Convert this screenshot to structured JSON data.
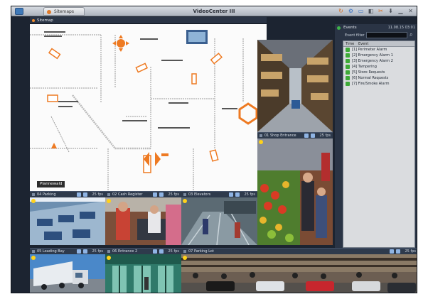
{
  "app": {
    "title": "VideoCenter III",
    "tab_label": "Sitemaps"
  },
  "toolbar_icons": [
    "refresh-icon",
    "settings-icon",
    "monitor-icon",
    "camera-icon",
    "cut-icon",
    "download-icon",
    "minimize-icon",
    "close-icon"
  ],
  "sitemap": {
    "header": "Sitemap",
    "plugin_label": "Plannewald"
  },
  "events": {
    "header": "Events",
    "date": "11.08.15 03:01",
    "filter_label": "Event filter",
    "columns": [
      "Time",
      "Event"
    ],
    "rows": [
      "[1] Perimeter Alarm",
      "[2] Emergency Alarm 1",
      "[3] Emergency Alarm 2",
      "[4] Tampering",
      "[5] Store Requests",
      "[6] Normal Requests",
      "[7] Fire/Smoke Alarm"
    ]
  },
  "cameras": {
    "shop_entrance": {
      "title": "01 Shop Entrance",
      "fps": "25 fps"
    },
    "parking": {
      "title": "04 Parking",
      "fps": "25 fps"
    },
    "cash_register": {
      "title": "02 Cash Register",
      "fps": "25 fps"
    },
    "elevators": {
      "title": "03 Elevators",
      "fps": "25 fps"
    },
    "loading_bay": {
      "title": "05 Loading Bay",
      "fps": "25 fps"
    },
    "entrance_2": {
      "title": "06 Entrance 2",
      "fps": "25 fps"
    },
    "parking_lot": {
      "title": "07 Parking Lot",
      "fps": "25 fps"
    }
  },
  "colors": {
    "accent": "#ee7a22",
    "panel": "#2a3445",
    "recording": "#ffd21a",
    "event_ok": "#3daa37"
  }
}
